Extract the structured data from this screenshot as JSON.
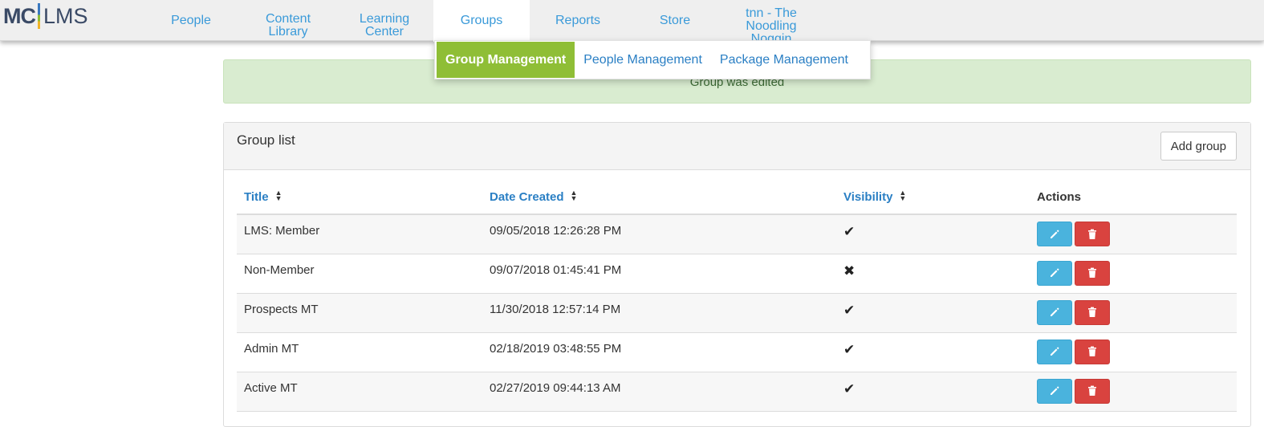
{
  "logo": {
    "mc": "MC",
    "lms": "LMS"
  },
  "nav": [
    {
      "label": "People"
    },
    {
      "label": "Content Library"
    },
    {
      "label": "Learning Center"
    },
    {
      "label": "Groups"
    },
    {
      "label": "Reports"
    },
    {
      "label": "Store"
    },
    {
      "label": "tnn - The Noodling Noggin"
    }
  ],
  "submenu": [
    {
      "label": "Group Management"
    },
    {
      "label": "People Management"
    },
    {
      "label": "Package Management"
    }
  ],
  "alert": {
    "message": "Group was edited"
  },
  "panel": {
    "title": "Group list",
    "add_label": "Add group"
  },
  "table": {
    "headers": {
      "title": "Title",
      "date": "Date Created",
      "visibility": "Visibility",
      "actions": "Actions"
    },
    "rows": [
      {
        "title": "LMS: Member",
        "date": "09/05/2018 12:26:28 PM",
        "visible": "✔"
      },
      {
        "title": "Non-Member",
        "date": "09/07/2018 01:45:41 PM",
        "visible": "✖"
      },
      {
        "title": "Prospects MT",
        "date": "11/30/2018 12:57:14 PM",
        "visible": "✔"
      },
      {
        "title": "Admin MT",
        "date": "02/18/2019 03:48:55 PM",
        "visible": "✔"
      },
      {
        "title": "Active MT",
        "date": "02/27/2019 09:44:13 AM",
        "visible": "✔"
      }
    ]
  },
  "colors": {
    "accent": "#3a9ad9",
    "active_submenu": "#8fbe36",
    "edit": "#4ab3dd",
    "delete": "#d9433f",
    "alert_bg": "#d9ecd0"
  },
  "icons": {
    "edit": "pencil-icon",
    "delete": "trash-icon",
    "sort": "sort-icon"
  }
}
